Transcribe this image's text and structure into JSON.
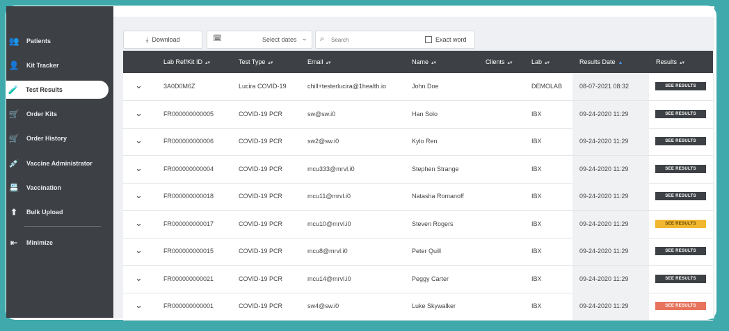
{
  "sidebar": {
    "items": [
      {
        "label": "Patients",
        "icon": "patients-icon"
      },
      {
        "label": "Kit Tracker",
        "icon": "kit-tracker-icon"
      },
      {
        "label": "Test Results",
        "icon": "test-tube-icon"
      },
      {
        "label": "Order Kits",
        "icon": "cart-icon"
      },
      {
        "label": "Order History",
        "icon": "cart-icon"
      },
      {
        "label": "Vaccine Administrator",
        "icon": "syringe-icon"
      },
      {
        "label": "Vaccination",
        "icon": "id-card-icon"
      },
      {
        "label": "Bulk Upload",
        "icon": "upload-icon"
      },
      {
        "label": "Minimize",
        "icon": "minimize-icon"
      }
    ],
    "active": "Test Results"
  },
  "toolbar": {
    "download_label": "Download",
    "date_placeholder": "Select dates",
    "search_placeholder": "Search",
    "exact_word_label": "Exact word"
  },
  "table": {
    "columns": [
      "Lab Ref/Kit ID",
      "Test Type",
      "Email",
      "Name",
      "Clients",
      "Lab",
      "Results Date",
      "Results"
    ],
    "result_button_label": "SEE RESULTS",
    "rows": [
      {
        "kit_id": "3A0D0M6Z",
        "test_type": "Lucira COVID-19",
        "email": "chill+testerlucira@1health.io",
        "name": "John Doe",
        "clients": "",
        "lab": "DEMOLAB",
        "date": "08-07-2021 08:32",
        "status": "dark"
      },
      {
        "kit_id": "FR000000000005",
        "test_type": "COVID-19 PCR",
        "email": "sw@sw.i0",
        "name": "Han Solo",
        "clients": "",
        "lab": "IBX",
        "date": "09-24-2020 11:29",
        "status": "dark"
      },
      {
        "kit_id": "FR000000000006",
        "test_type": "COVID-19 PCR",
        "email": "sw2@sw.i0",
        "name": "Kylo Ren",
        "clients": "",
        "lab": "IBX",
        "date": "09-24-2020 11:29",
        "status": "dark"
      },
      {
        "kit_id": "FR000000000004",
        "test_type": "COVID-19 PCR",
        "email": "mcu333@mrvl.i0",
        "name": "Stephen Strange",
        "clients": "",
        "lab": "IBX",
        "date": "09-24-2020 11:29",
        "status": "dark"
      },
      {
        "kit_id": "FR000000000018",
        "test_type": "COVID-19 PCR",
        "email": "mcu11@mrvl.i0",
        "name": "Natasha Romanoff",
        "clients": "",
        "lab": "IBX",
        "date": "09-24-2020 11:29",
        "status": "dark"
      },
      {
        "kit_id": "FR000000000017",
        "test_type": "COVID-19 PCR",
        "email": "mcu10@mrvl.i0",
        "name": "Steven Rogers",
        "clients": "",
        "lab": "IBX",
        "date": "09-24-2020 11:29",
        "status": "yellow"
      },
      {
        "kit_id": "FR000000000015",
        "test_type": "COVID-19 PCR",
        "email": "mcu8@mrvl.i0",
        "name": "Peter Quill",
        "clients": "",
        "lab": "IBX",
        "date": "09-24-2020 11:29",
        "status": "dark"
      },
      {
        "kit_id": "FR000000000021",
        "test_type": "COVID-19 PCR",
        "email": "mcu14@mrvl.i0",
        "name": "Peggy Carter",
        "clients": "",
        "lab": "IBX",
        "date": "09-24-2020 11:29",
        "status": "dark"
      },
      {
        "kit_id": "FR000000000001",
        "test_type": "COVID-19 PCR",
        "email": "sw4@sw.i0",
        "name": "Luke Skywalker",
        "clients": "",
        "lab": "IBX",
        "date": "09-24-2020 11:29",
        "status": "red"
      }
    ]
  },
  "colors": {
    "frame": "#3fa9ab",
    "sidebar": "#3d4145",
    "result_dark": "#3d4145",
    "result_yellow": "#f2b731",
    "result_red": "#e8735c"
  }
}
